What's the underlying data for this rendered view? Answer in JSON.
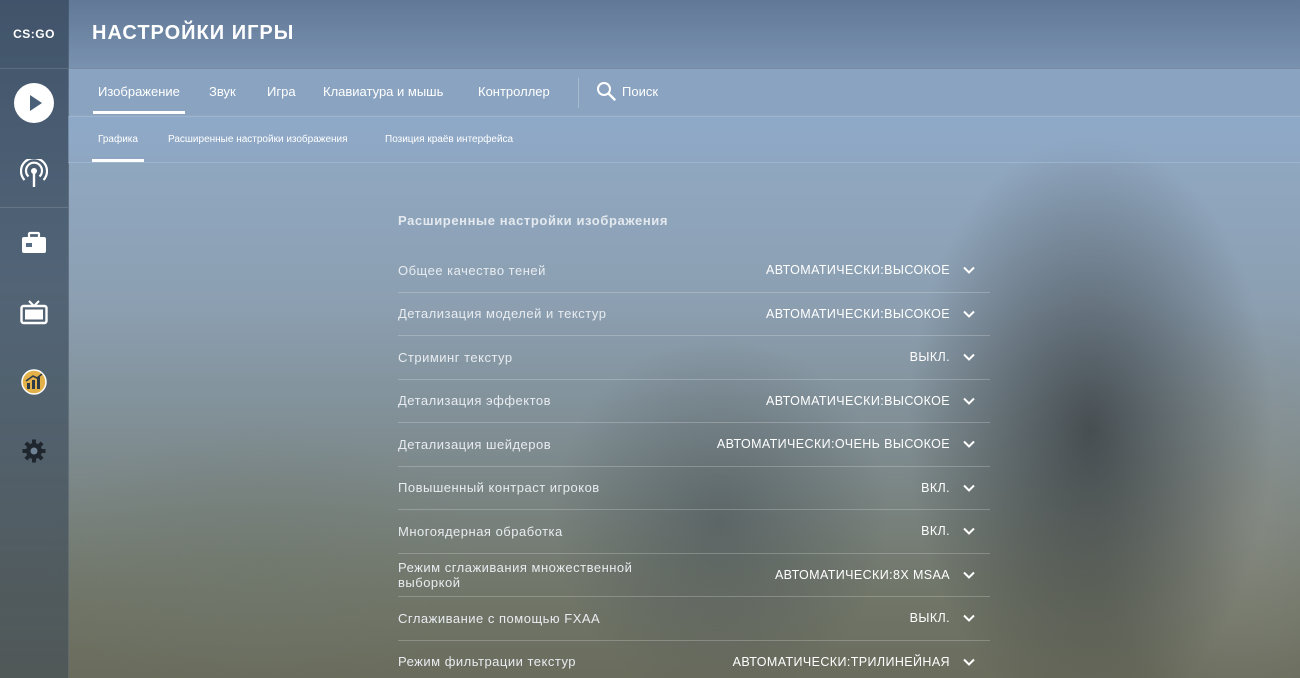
{
  "sidebar": {
    "logo": "CS:GO",
    "items": [
      {
        "name": "play-icon"
      },
      {
        "name": "broadcast-icon"
      },
      {
        "name": "inventory-icon"
      },
      {
        "name": "tv-icon"
      },
      {
        "name": "stats-icon"
      },
      {
        "name": "gear-icon"
      }
    ]
  },
  "header": {
    "title": "НАСТРОЙКИ ИГРЫ"
  },
  "tabs": {
    "image": "Изображение",
    "sound": "Звук",
    "game": "Игра",
    "keyboard": "Клавиатура и мышь",
    "controller": "Контроллер",
    "search_label": "Поиск",
    "active": "image"
  },
  "subtabs": {
    "graphics": "Графика",
    "advanced": "Расширенные настройки изображения",
    "hud_edges": "Позиция краёв интерфейса",
    "active": "graphics"
  },
  "section": {
    "title": "Расширенные настройки изображения"
  },
  "settings": [
    {
      "label": "Общее качество теней",
      "value": "АВТОМАТИЧЕСКИ:ВЫСОКОЕ"
    },
    {
      "label": "Детализация моделей и текстур",
      "value": "АВТОМАТИЧЕСКИ:ВЫСОКОЕ"
    },
    {
      "label": "Стриминг текстур",
      "value": "ВЫКЛ."
    },
    {
      "label": "Детализация эффектов",
      "value": "АВТОМАТИЧЕСКИ:ВЫСОКОЕ"
    },
    {
      "label": "Детализация шейдеров",
      "value": "АВТОМАТИЧЕСКИ:ОЧЕНЬ ВЫСОКОЕ"
    },
    {
      "label": "Повышенный контраст игроков",
      "value": "ВКЛ."
    },
    {
      "label": "Многоядерная обработка",
      "value": "ВКЛ."
    },
    {
      "label": "Режим сглаживания множественной выборкой",
      "value": "АВТОМАТИЧЕСКИ:8X MSAA"
    },
    {
      "label": "Сглаживание с помощью FXAA",
      "value": "ВЫКЛ."
    },
    {
      "label": "Режим фильтрации текстур",
      "value": "АВТОМАТИЧЕСКИ:ТРИЛИНЕЙНАЯ"
    }
  ],
  "colors": {
    "text": "#ffffff",
    "label": "#e8ecf0",
    "divider": "rgba(255,255,255,0.22)"
  }
}
